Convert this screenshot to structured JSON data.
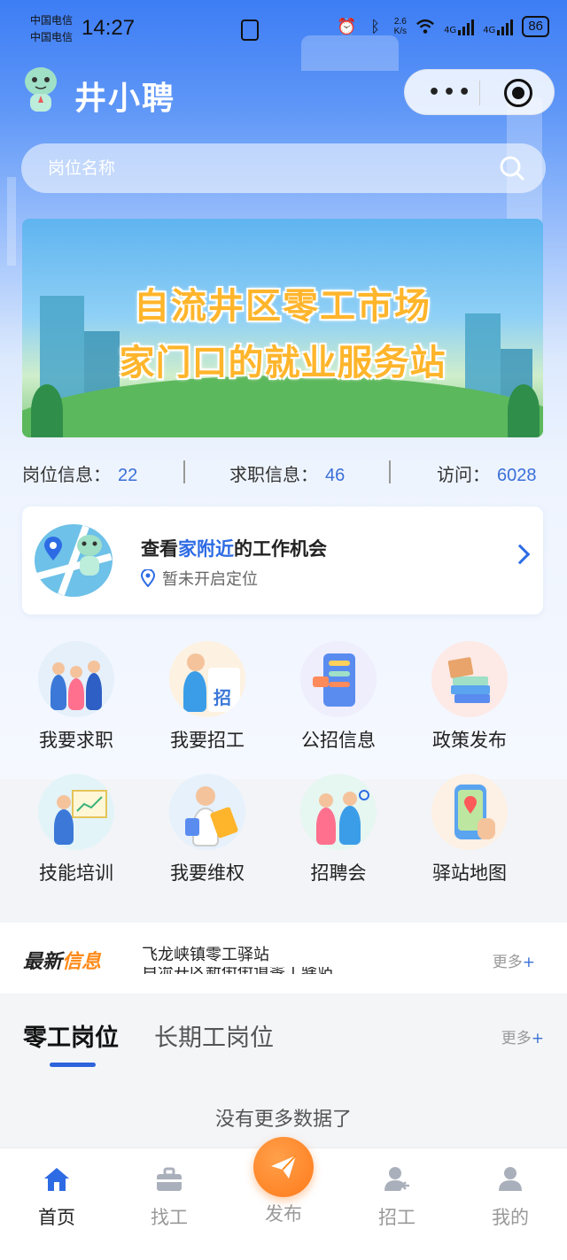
{
  "status_bar": {
    "carrier1": "中国电信",
    "carrier2": "中国电信",
    "time": "14:27",
    "speed_value": "2.6",
    "speed_unit": "K/s",
    "net1": "4G",
    "net2": "4G",
    "battery": "86"
  },
  "header": {
    "title": "井小聘"
  },
  "search": {
    "placeholder": "岗位名称"
  },
  "banner": {
    "line1": "自流井区零工市场",
    "line2": "家门口的就业服务站"
  },
  "stats": {
    "jobs_label": "岗位信息：",
    "jobs_value": "22",
    "seekers_label": "求职信息：",
    "seekers_value": "46",
    "visits_label": "访问：",
    "visits_value": "6028"
  },
  "nearby": {
    "title_prefix": "查看",
    "title_highlight": "家附近",
    "title_suffix": "的工作机会",
    "location_status": "暂未开启定位"
  },
  "menu": [
    {
      "label": "我要求职",
      "icon": "job-seeking-icon"
    },
    {
      "label": "我要招工",
      "icon": "recruit-icon"
    },
    {
      "label": "公招信息",
      "icon": "public-recruit-icon"
    },
    {
      "label": "政策发布",
      "icon": "policy-icon"
    },
    {
      "label": "技能培训",
      "icon": "training-icon"
    },
    {
      "label": "我要维权",
      "icon": "rights-icon"
    },
    {
      "label": "招聘会",
      "icon": "job-fair-icon"
    },
    {
      "label": "驿站地图",
      "icon": "station-map-icon"
    }
  ],
  "news": {
    "logo_part1": "最新",
    "logo_part2": "信息",
    "line1": "飞龙峡镇零工驿站",
    "line2": "自流井区新街街道零工驿站",
    "more": "更多",
    "more_plus": "+"
  },
  "tabs": {
    "active": "零工岗位",
    "inactive": "长期工岗位",
    "more": "更多",
    "more_plus": "+",
    "empty": "没有更多数据了"
  },
  "bottom_nav": {
    "home": "首页",
    "find_workers": "找工",
    "publish": "发布",
    "recruit": "招工",
    "mine": "我的"
  },
  "colors": {
    "accent": "#2d6be4",
    "orange": "#ff8a1a"
  }
}
